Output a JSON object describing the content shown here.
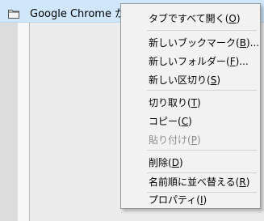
{
  "bookmark_bar": {
    "folder_icon": "folder-icon",
    "label": "Google Chrome から"
  },
  "context_menu": {
    "items": [
      {
        "text": "タブですべて開く",
        "mnemonic": "O",
        "suffix": ""
      },
      {
        "text": "新しいブックマーク",
        "mnemonic": "B",
        "suffix": "..."
      },
      {
        "text": "新しいフォルダー",
        "mnemonic": "F",
        "suffix": "..."
      },
      {
        "text": "新しい区切り",
        "mnemonic": "S",
        "suffix": ""
      },
      {
        "text": "切り取り",
        "mnemonic": "T",
        "suffix": ""
      },
      {
        "text": "コピー",
        "mnemonic": "C",
        "suffix": ""
      },
      {
        "text": "貼り付け",
        "mnemonic": "P",
        "suffix": "",
        "disabled": true
      },
      {
        "text": "削除",
        "mnemonic": "D",
        "suffix": ""
      },
      {
        "text": "名前順に並べ替える",
        "mnemonic": "R",
        "suffix": ""
      },
      {
        "text": "プロパティ",
        "mnemonic": "I",
        "suffix": ""
      }
    ]
  }
}
